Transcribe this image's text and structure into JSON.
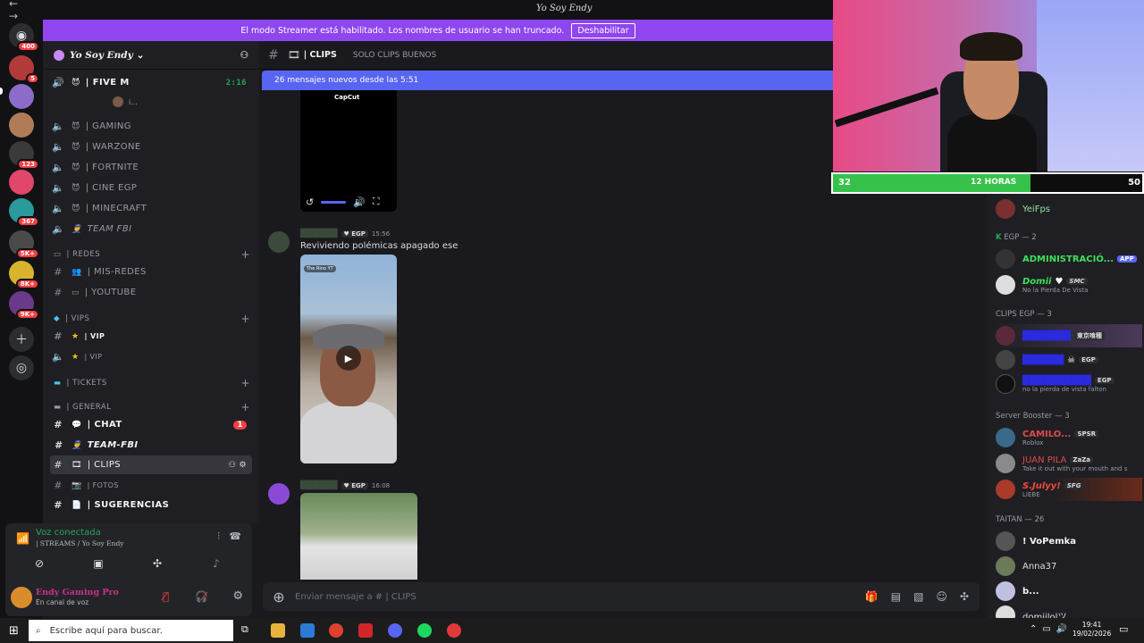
{
  "window": {
    "title": "Yo Soy Endy",
    "nav": "← →"
  },
  "banner": {
    "text": "El modo Streamer está habilitado. Los nombres de usuario se han truncado.",
    "button": "Deshabilitar"
  },
  "servers": [
    {
      "badge": "400"
    },
    {
      "badge": "5"
    },
    {
      "badge": ""
    },
    {
      "badge": ""
    },
    {
      "badge": "123"
    },
    {
      "badge": ""
    },
    {
      "badge": "367"
    },
    {
      "badge": "5K+"
    },
    {
      "badge": "8K+"
    },
    {
      "badge": "9K+"
    }
  ],
  "guild": {
    "name": "Yo Soy Endy",
    "chevron": "⌄"
  },
  "channels": {
    "five_m": "| FIVE M",
    "five_m_timer": "2:16",
    "sub_user": "i...",
    "gaming": "| GAMING",
    "warzone": "| WARZONE",
    "fortnite": "| FORTNITE",
    "cine": "| CINE EGP",
    "minecraft": "| MINECRAFT",
    "team_fbi_voice": "TEAM FBI",
    "cat_redes": "| REDES",
    "mis_redes": "| MIS-REDES",
    "youtube": "| YOUTUBE",
    "cat_vips": "| VIPS",
    "vip1": "| VIP",
    "vip2": "| VIP",
    "cat_tickets": "| TICKETS",
    "cat_general": "| GENERAL",
    "chat": "| CHAT",
    "chat_badge": "1",
    "team_fbi": "TEAM-FBI",
    "clips": "| CLIPS",
    "fotos": "| FOTOS",
    "sugerencias": "| SUGERENCIAS"
  },
  "voice": {
    "status": "Voz conectada",
    "channel": "| STREAMS / Yo Soy Endy"
  },
  "user": {
    "name": "Endy Gaming Pro",
    "status": "En canal de voz"
  },
  "chat": {
    "channel": "| CLIPS",
    "topic": "SOLO CLIPS BUENOS",
    "new_messages": "26 mensajes nuevos desde las 5:51",
    "video_brand": "CapCut",
    "msg1": {
      "tag": "EGP",
      "time": "15:56",
      "text": "Reviviendo polémicas apagado ese",
      "video_label": "The Rino YT"
    },
    "msg2": {
      "tag": "EGP",
      "time": "16:08"
    },
    "placeholder": "Enviar mensaje a #  | CLIPS"
  },
  "subgoal": {
    "left": "32",
    "middle": "12 HORAS",
    "right": "50",
    "progress": 0.64
  },
  "members": {
    "yeifps": "YeiFps",
    "grp_egp": "EGP — 2",
    "admin": "ADMINISTRACIÓ...",
    "admin_tag": "APP",
    "domii": "Domii",
    "domii_tag": "SMC",
    "domii_status": "No la Pierda De Vista",
    "grp_clips": "CLIPS EGP — 3",
    "clips1_tag": "東京喰種",
    "clips2_tag": "EGP",
    "clips3_tag": "EGP",
    "clips3_status": "no la pierda de vista falton",
    "grp_booster": "Server Booster — 3",
    "camilo": "CAMILO...",
    "camilo_tag": "SPSR",
    "camilo_status": "Roblox",
    "juan": "JUAN PILA",
    "juan_tag": "ZaZa",
    "juan_status": "Take it out with your mouth and s",
    "julyy": "S.Julyy!",
    "julyy_tag": "SFG",
    "julyy_status": "LIEBE",
    "grp_taitan": "TAITAN — 26",
    "vopemka": "! VoPemka",
    "anna": "Anna37",
    "b": "b...",
    "domiilol": "domiilolツ"
  },
  "taskbar": {
    "search": "Escribe aquí para buscar.",
    "time": "19:41",
    "date": "19/02/2026"
  }
}
